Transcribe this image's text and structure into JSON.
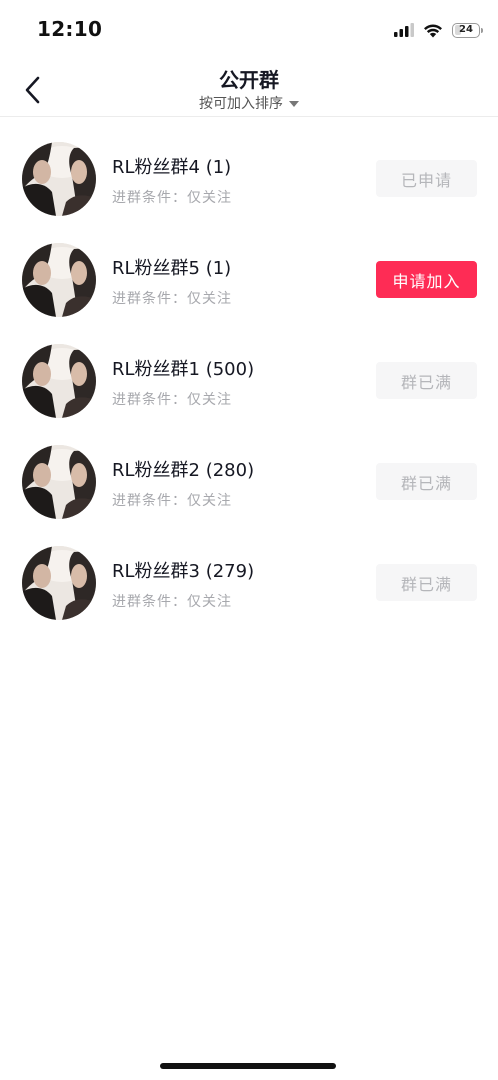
{
  "status_bar": {
    "time": "12:10",
    "battery_level": "24"
  },
  "header": {
    "title": "公开群",
    "sort_label": "按可加入排序"
  },
  "groups": [
    {
      "name": "RL粉丝群4 (1)",
      "condition": "进群条件：仅关注",
      "action": "已申请",
      "action_state": "disabled"
    },
    {
      "name": "RL粉丝群5 (1)",
      "condition": "进群条件：仅关注",
      "action": "申请加入",
      "action_state": "primary"
    },
    {
      "name": "RL粉丝群1 (500)",
      "condition": "进群条件：仅关注",
      "action": "群已满",
      "action_state": "disabled"
    },
    {
      "name": "RL粉丝群2 (280)",
      "condition": "进群条件：仅关注",
      "action": "群已满",
      "action_state": "disabled"
    },
    {
      "name": "RL粉丝群3 (279)",
      "condition": "进群条件：仅关注",
      "action": "群已满",
      "action_state": "disabled"
    }
  ],
  "colors": {
    "accent": "#fe2c55",
    "disabled_bg": "#f6f6f7",
    "disabled_text": "#b5b6ba"
  },
  "icons": {
    "back": "chevron-left-icon",
    "sort": "caret-down-icon"
  }
}
